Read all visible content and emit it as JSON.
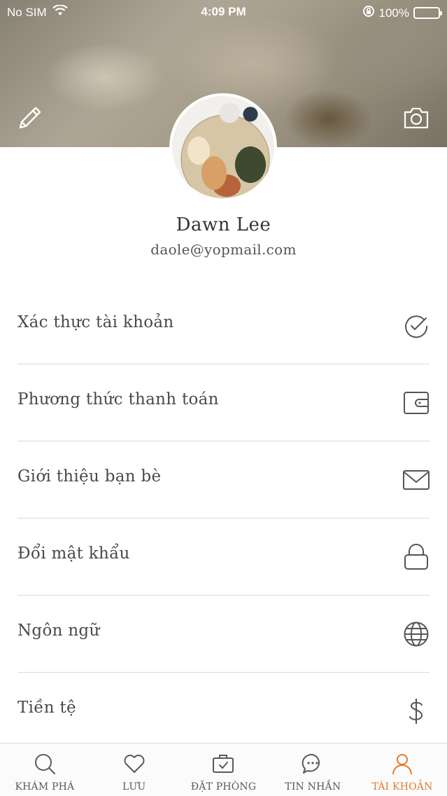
{
  "status_bar": {
    "carrier": "No SIM",
    "time": "4:09 PM",
    "battery": "100%"
  },
  "profile": {
    "name": "Dawn Lee",
    "email": "daole@yopmail.com"
  },
  "header_icons": [
    "edit-icon",
    "camera-icon"
  ],
  "menu": [
    {
      "label": "Xác thực tài khoản",
      "icon": "verified-check-icon"
    },
    {
      "label": "Phương thức thanh toán",
      "icon": "wallet-icon"
    },
    {
      "label": "Giới thiệu bạn bè",
      "icon": "envelope-icon"
    },
    {
      "label": "Đổi mật khẩu",
      "icon": "lock-icon"
    },
    {
      "label": "Ngôn ngữ",
      "icon": "globe-icon"
    },
    {
      "label": "Tiền tệ",
      "icon": "dollar-icon"
    }
  ],
  "tabs": [
    {
      "label": "KHÁM PHÁ",
      "icon": "search-icon",
      "active": false
    },
    {
      "label": "LƯU",
      "icon": "heart-icon",
      "active": false
    },
    {
      "label": "ĐẶT PHÒNG",
      "icon": "booking-bag-icon",
      "active": false
    },
    {
      "label": "TIN NHẮN",
      "icon": "chat-bubble-icon",
      "active": false
    },
    {
      "label": "TÀI KHOẢN",
      "icon": "user-icon",
      "active": true
    }
  ],
  "colors": {
    "accent": "#e07b2e",
    "text": "#4a4a4a",
    "icon": "#555555",
    "divider": "#d9d9d9"
  }
}
